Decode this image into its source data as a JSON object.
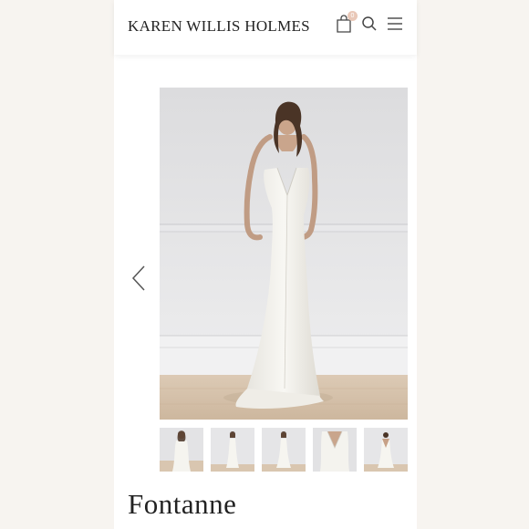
{
  "header": {
    "brand": "KAREN WILLIS HOLMES",
    "cart_count": "0",
    "icons": [
      "shopping-bag-icon",
      "search-icon",
      "hamburger-menu-icon"
    ]
  },
  "gallery": {
    "main_image": "bride-in-white-v-neck-gown-photo",
    "prev_icon": "chevron-left-icon",
    "thumbnails": [
      "thumbnail-front-closeup",
      "thumbnail-full-length",
      "thumbnail-full-length-front",
      "thumbnail-bodice-detail",
      "thumbnail-back-view"
    ]
  },
  "product": {
    "title": "Fontanne"
  },
  "colors": {
    "page_bg": "#f7f4f0",
    "panel_bg": "#ffffff",
    "badge": "#e9c8b8",
    "text": "#222222"
  }
}
